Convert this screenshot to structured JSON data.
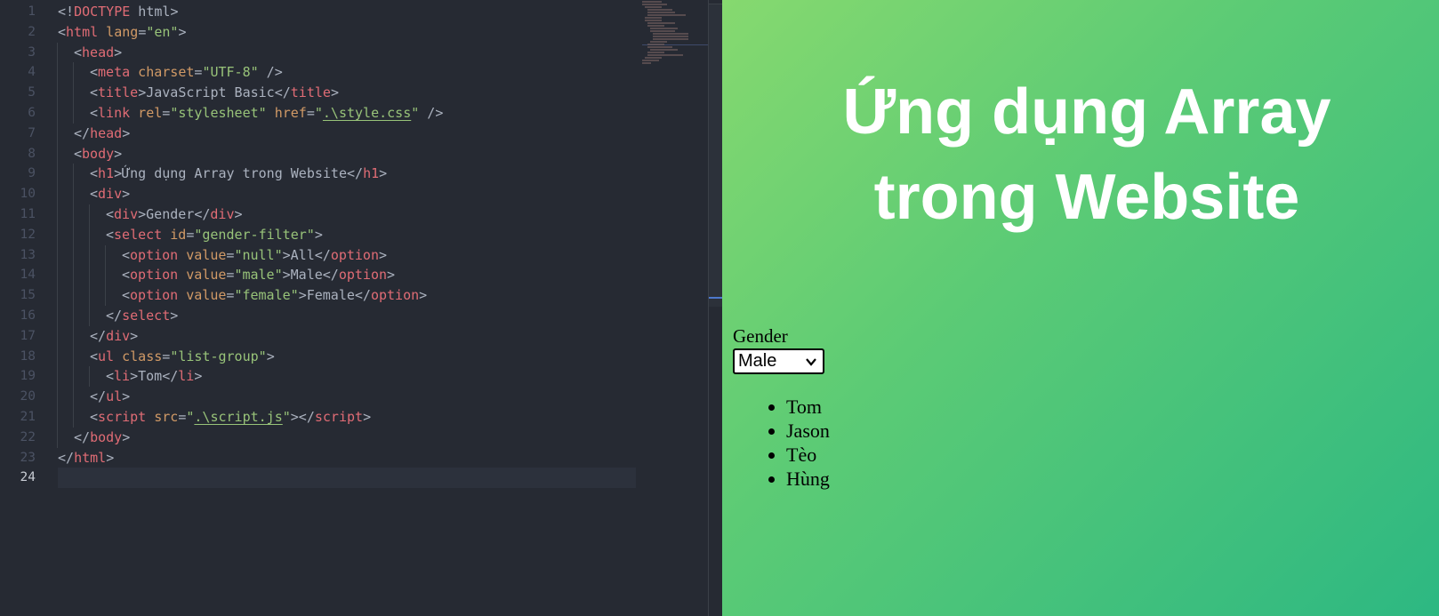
{
  "editor": {
    "line_numbers": [
      "1",
      "2",
      "3",
      "4",
      "5",
      "6",
      "7",
      "8",
      "9",
      "10",
      "11",
      "12",
      "13",
      "14",
      "15",
      "16",
      "17",
      "18",
      "19",
      "20",
      "21",
      "22",
      "23",
      "24"
    ],
    "lines": [
      {
        "indent": 0,
        "tokens": [
          [
            "p",
            "<!"
          ],
          [
            "t",
            "DOCTYPE"
          ],
          [
            "x",
            " html"
          ],
          [
            "p",
            ">"
          ]
        ]
      },
      {
        "indent": 0,
        "tokens": [
          [
            "p",
            "<"
          ],
          [
            "t",
            "html"
          ],
          [
            "a",
            " lang"
          ],
          [
            "p",
            "="
          ],
          [
            "s",
            "\"en\""
          ],
          [
            "p",
            ">"
          ]
        ]
      },
      {
        "indent": 1,
        "tokens": [
          [
            "p",
            "<"
          ],
          [
            "t",
            "head"
          ],
          [
            "p",
            ">"
          ]
        ]
      },
      {
        "indent": 2,
        "tokens": [
          [
            "p",
            "<"
          ],
          [
            "t",
            "meta"
          ],
          [
            "a",
            " charset"
          ],
          [
            "p",
            "="
          ],
          [
            "s",
            "\"UTF-8\""
          ],
          [
            "p",
            " />"
          ]
        ]
      },
      {
        "indent": 2,
        "tokens": [
          [
            "p",
            "<"
          ],
          [
            "t",
            "title"
          ],
          [
            "p",
            ">"
          ],
          [
            "x",
            "JavaScript Basic"
          ],
          [
            "p",
            "</"
          ],
          [
            "t",
            "title"
          ],
          [
            "p",
            ">"
          ]
        ]
      },
      {
        "indent": 2,
        "tokens": [
          [
            "p",
            "<"
          ],
          [
            "t",
            "link"
          ],
          [
            "a",
            " rel"
          ],
          [
            "p",
            "="
          ],
          [
            "s",
            "\"stylesheet\""
          ],
          [
            "a",
            " href"
          ],
          [
            "p",
            "="
          ],
          [
            "s",
            "\""
          ],
          [
            "sl",
            ".\\style.css"
          ],
          [
            "s",
            "\""
          ],
          [
            "p",
            " />"
          ]
        ]
      },
      {
        "indent": 1,
        "tokens": [
          [
            "p",
            "</"
          ],
          [
            "t",
            "head"
          ],
          [
            "p",
            ">"
          ]
        ]
      },
      {
        "indent": 1,
        "tokens": [
          [
            "p",
            "<"
          ],
          [
            "t",
            "body"
          ],
          [
            "p",
            ">"
          ]
        ]
      },
      {
        "indent": 2,
        "tokens": [
          [
            "p",
            "<"
          ],
          [
            "t",
            "h1"
          ],
          [
            "p",
            ">"
          ],
          [
            "x",
            "Ứng dụng Array trong Website"
          ],
          [
            "p",
            "</"
          ],
          [
            "t",
            "h1"
          ],
          [
            "p",
            ">"
          ]
        ]
      },
      {
        "indent": 2,
        "tokens": [
          [
            "p",
            "<"
          ],
          [
            "t",
            "div"
          ],
          [
            "p",
            ">"
          ]
        ]
      },
      {
        "indent": 3,
        "tokens": [
          [
            "p",
            "<"
          ],
          [
            "t",
            "div"
          ],
          [
            "p",
            ">"
          ],
          [
            "x",
            "Gender"
          ],
          [
            "p",
            "</"
          ],
          [
            "t",
            "div"
          ],
          [
            "p",
            ">"
          ]
        ]
      },
      {
        "indent": 3,
        "tokens": [
          [
            "p",
            "<"
          ],
          [
            "t",
            "select"
          ],
          [
            "a",
            " id"
          ],
          [
            "p",
            "="
          ],
          [
            "s",
            "\"gender-filter\""
          ],
          [
            "p",
            ">"
          ]
        ]
      },
      {
        "indent": 4,
        "tokens": [
          [
            "p",
            "<"
          ],
          [
            "t",
            "option"
          ],
          [
            "a",
            " value"
          ],
          [
            "p",
            "="
          ],
          [
            "s",
            "\"null\""
          ],
          [
            "p",
            ">"
          ],
          [
            "x",
            "All"
          ],
          [
            "p",
            "</"
          ],
          [
            "t",
            "option"
          ],
          [
            "p",
            ">"
          ]
        ]
      },
      {
        "indent": 4,
        "tokens": [
          [
            "p",
            "<"
          ],
          [
            "t",
            "option"
          ],
          [
            "a",
            " value"
          ],
          [
            "p",
            "="
          ],
          [
            "s",
            "\"male\""
          ],
          [
            "p",
            ">"
          ],
          [
            "x",
            "Male"
          ],
          [
            "p",
            "</"
          ],
          [
            "t",
            "option"
          ],
          [
            "p",
            ">"
          ]
        ]
      },
      {
        "indent": 4,
        "tokens": [
          [
            "p",
            "<"
          ],
          [
            "t",
            "option"
          ],
          [
            "a",
            " value"
          ],
          [
            "p",
            "="
          ],
          [
            "s",
            "\"female\""
          ],
          [
            "p",
            ">"
          ],
          [
            "x",
            "Female"
          ],
          [
            "p",
            "</"
          ],
          [
            "t",
            "option"
          ],
          [
            "p",
            ">"
          ]
        ]
      },
      {
        "indent": 3,
        "tokens": [
          [
            "p",
            "</"
          ],
          [
            "t",
            "select"
          ],
          [
            "p",
            ">"
          ]
        ]
      },
      {
        "indent": 2,
        "tokens": [
          [
            "p",
            "</"
          ],
          [
            "t",
            "div"
          ],
          [
            "p",
            ">"
          ]
        ]
      },
      {
        "indent": 2,
        "tokens": [
          [
            "p",
            "<"
          ],
          [
            "t",
            "ul"
          ],
          [
            "a",
            " class"
          ],
          [
            "p",
            "="
          ],
          [
            "s",
            "\"list-group\""
          ],
          [
            "p",
            ">"
          ]
        ]
      },
      {
        "indent": 3,
        "tokens": [
          [
            "p",
            "<"
          ],
          [
            "t",
            "li"
          ],
          [
            "p",
            ">"
          ],
          [
            "x",
            "Tom"
          ],
          [
            "p",
            "</"
          ],
          [
            "t",
            "li"
          ],
          [
            "p",
            ">"
          ]
        ]
      },
      {
        "indent": 2,
        "tokens": [
          [
            "p",
            "</"
          ],
          [
            "t",
            "ul"
          ],
          [
            "p",
            ">"
          ]
        ]
      },
      {
        "indent": 2,
        "tokens": [
          [
            "p",
            "<"
          ],
          [
            "t",
            "script"
          ],
          [
            "a",
            " src"
          ],
          [
            "p",
            "="
          ],
          [
            "s",
            "\""
          ],
          [
            "sl",
            ".\\script.js"
          ],
          [
            "s",
            "\""
          ],
          [
            "p",
            "></"
          ],
          [
            "t",
            "script"
          ],
          [
            "p",
            ">"
          ]
        ]
      },
      {
        "indent": 1,
        "tokens": [
          [
            "p",
            "</"
          ],
          [
            "t",
            "body"
          ],
          [
            "p",
            ">"
          ]
        ]
      },
      {
        "indent": 0,
        "tokens": [
          [
            "p",
            "</"
          ],
          [
            "t",
            "html"
          ],
          [
            "p",
            ">"
          ]
        ]
      },
      {
        "indent": 0,
        "tokens": []
      }
    ],
    "current_line": 24
  },
  "preview": {
    "heading": "Ứng dụng Array trong Website",
    "gender_label": "Gender",
    "select_value": "Male",
    "list_items": [
      "Tom",
      "Jason",
      "Tèo",
      "Hùng"
    ]
  }
}
